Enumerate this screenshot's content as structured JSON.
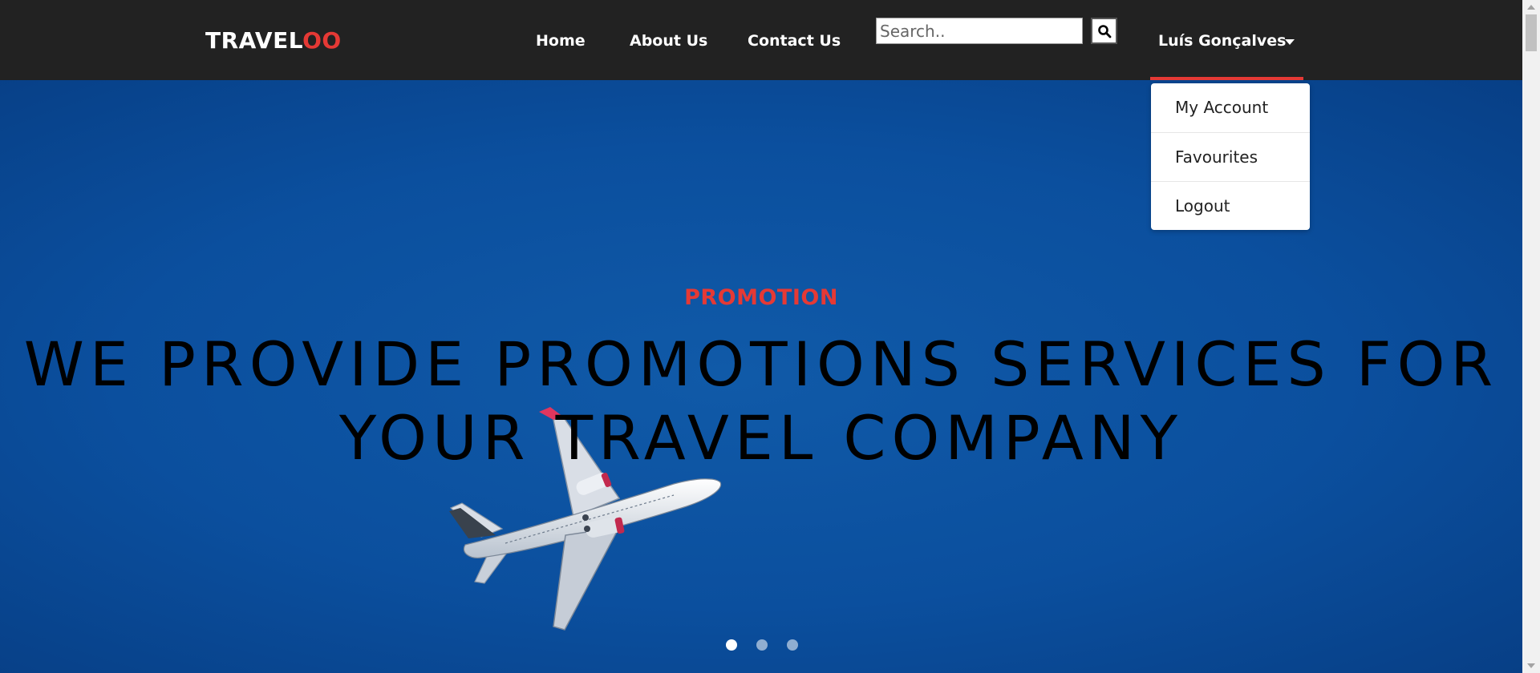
{
  "navbar": {
    "logo_primary": "TRAVEL",
    "logo_accent": "OO",
    "links": [
      "Home",
      "About Us",
      "Contact Us"
    ],
    "search_placeholder": "Search..",
    "search_icon": "search-icon",
    "user_name": "Luís Gonçalves"
  },
  "user_menu": {
    "items": [
      "My Account",
      "Favourites",
      "Logout"
    ]
  },
  "hero": {
    "eyebrow": "PROMOTION",
    "headline_line1": "WE PROVIDE PROMOTIONS SERVICES FOR",
    "headline_line2": "YOUR TRAVEL COMPANY",
    "image": "airplane-in-blue-sky",
    "carousel_active_index": 0,
    "carousel_count": 3
  },
  "colors": {
    "navbar_bg": "#222222",
    "accent": "#e53935",
    "sky": "#0b4d9c",
    "headline_text": "#000000"
  }
}
